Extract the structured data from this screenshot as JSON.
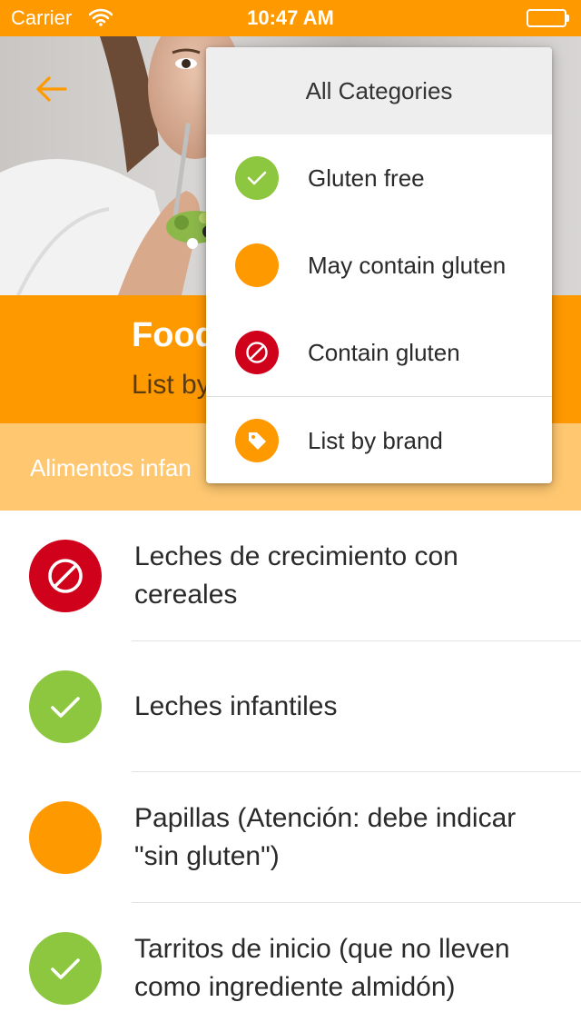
{
  "status_bar": {
    "carrier": "Carrier",
    "time": "10:47 AM"
  },
  "header": {
    "title": "Food",
    "subtitle": "List by"
  },
  "category": {
    "name": "Alimentos infan"
  },
  "popup": {
    "header": "All Categories",
    "items": [
      {
        "label": "Gluten free",
        "icon": "check-icon",
        "color": "#8DC63F"
      },
      {
        "label": "May contain gluten",
        "icon": "circle-icon",
        "color": "#FF9900"
      },
      {
        "label": "Contain gluten",
        "icon": "prohibited-icon",
        "color": "#D0021B"
      },
      {
        "label": "List by brand",
        "icon": "tag-icon",
        "color": "#FF9900"
      }
    ]
  },
  "foods": [
    {
      "label": "Leches de crecimiento con cereales",
      "status": "contain-gluten"
    },
    {
      "label": "Leches infantiles",
      "status": "gluten-free"
    },
    {
      "label": "Papillas (Atención: debe indicar \"sin gluten\")",
      "status": "may-contain-gluten"
    },
    {
      "label": "Tarritos de inicio (que no lleven como ingrediente almidón)",
      "status": "gluten-free"
    }
  ],
  "colors": {
    "accent": "#FF9900",
    "gluten_free": "#8DC63F",
    "may_contain": "#FF9900",
    "contains": "#D0021B",
    "category_band": "#FFC870"
  }
}
